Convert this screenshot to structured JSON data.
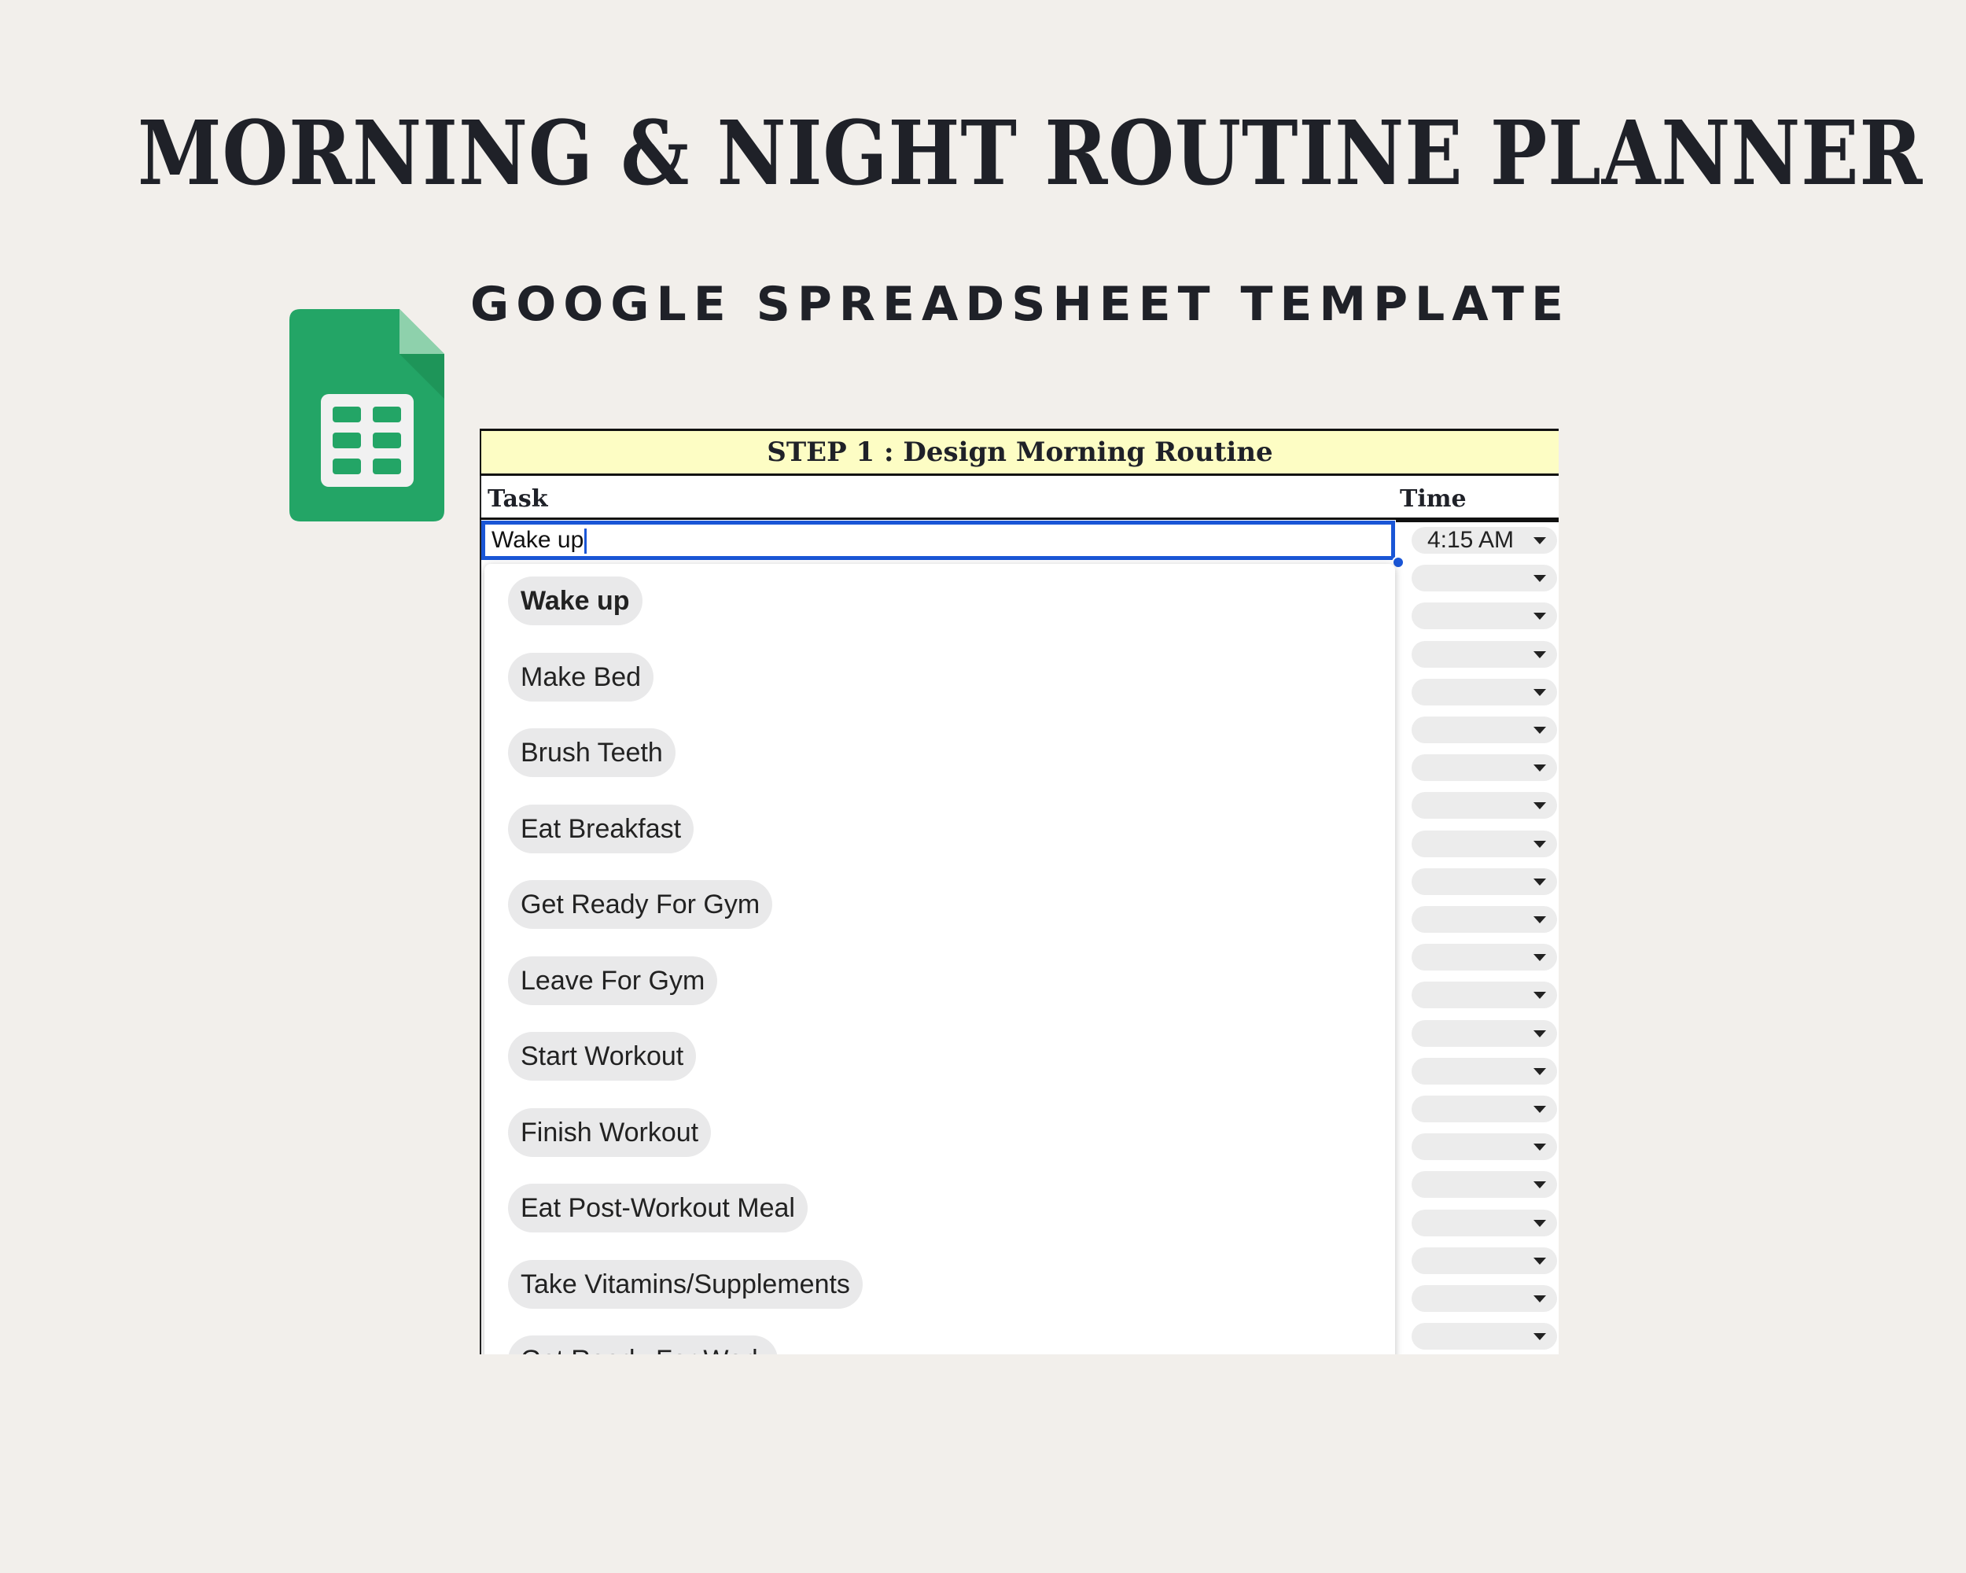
{
  "title": "MORNING & NIGHT ROUTINE PLANNER",
  "subtitle": "GOOGLE SPREADSHEET TEMPLATE",
  "logo": {
    "name": "google-sheets-icon",
    "color": "#23a566",
    "dark": "#188038"
  },
  "sheet": {
    "step_header": "STEP 1 : Design Morning Routine",
    "columns": {
      "task": "Task",
      "time": "Time"
    },
    "task_input": {
      "value": "Wake up"
    },
    "dropdown_options": [
      "Wake up",
      "Make Bed",
      "Brush Teeth",
      "Eat Breakfast",
      "Get Ready For Gym",
      "Leave For Gym",
      "Start Workout",
      "Finish Workout",
      "Eat Post-Workout Meal",
      "Take Vitamins/Supplements",
      "Get Ready For Work"
    ],
    "first_time": "4:15 AM",
    "colors": {
      "header_bg": "#fdfdc4",
      "selection": "#1a56d6",
      "chip": "#e9e9ea"
    }
  }
}
